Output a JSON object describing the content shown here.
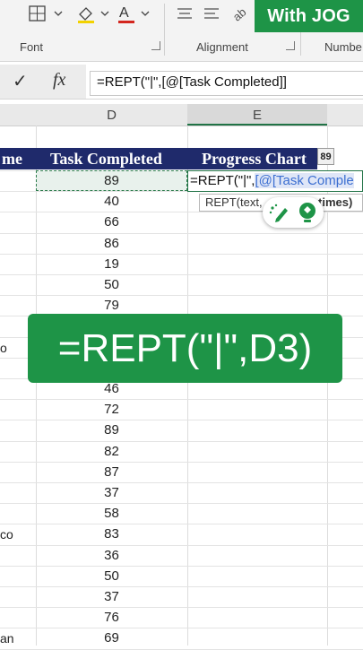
{
  "ribbon": {
    "groups": [
      {
        "label": "Font"
      },
      {
        "label": "Alignment"
      },
      {
        "label": "Numbe"
      }
    ]
  },
  "badge": {
    "text": "With JOG"
  },
  "formula_bar": {
    "check_glyph": "✓",
    "fx_glyph": "fx",
    "formula": "=REPT(\"|\",[@[Task Completed]]"
  },
  "columns": [
    {
      "letter": "D"
    },
    {
      "letter": "E"
    }
  ],
  "table": {
    "partial_header": "me",
    "headers": [
      "Task Completed",
      "Progress Chart"
    ],
    "tooltip_value": "89",
    "task_completed": [
      "89",
      "40",
      "66",
      "86",
      "19",
      "50",
      "79",
      "",
      "",
      "",
      "46",
      "72",
      "89",
      "82",
      "87",
      "37",
      "58",
      "83",
      "36",
      "50",
      "37",
      "76",
      "69"
    ],
    "col_a_fragments": [
      "",
      "",
      "",
      "",
      "",
      "",
      "",
      "",
      "o",
      "",
      "",
      "",
      "",
      "",
      "",
      "",
      "",
      "co",
      "",
      "",
      "",
      "",
      "an"
    ]
  },
  "edit_cell": {
    "prefix": "=REPT(\"|\",",
    "ref": "[@[Task Comple"
  },
  "tooltip": {
    "text": "REPT(text,",
    "arg": "times)"
  },
  "overlay": {
    "text": "=REPT(\"|\",D3)"
  }
}
